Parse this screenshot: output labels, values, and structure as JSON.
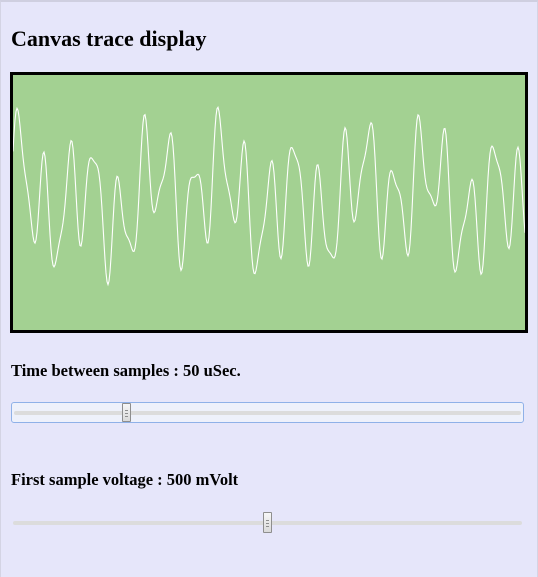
{
  "page": {
    "title": "Canvas trace display"
  },
  "trace": {
    "background_color": "#a3d192",
    "trace_color": "#ffffff",
    "border_color": "#000000"
  },
  "controls": {
    "time_label": "Time between samples : 50 uSec.",
    "time_slider_fraction": 0.22,
    "voltage_label": "First sample voltage : 500 mVolt",
    "voltage_slider_fraction": 0.5,
    "focus_ring_color": "#8fb1e8"
  }
}
